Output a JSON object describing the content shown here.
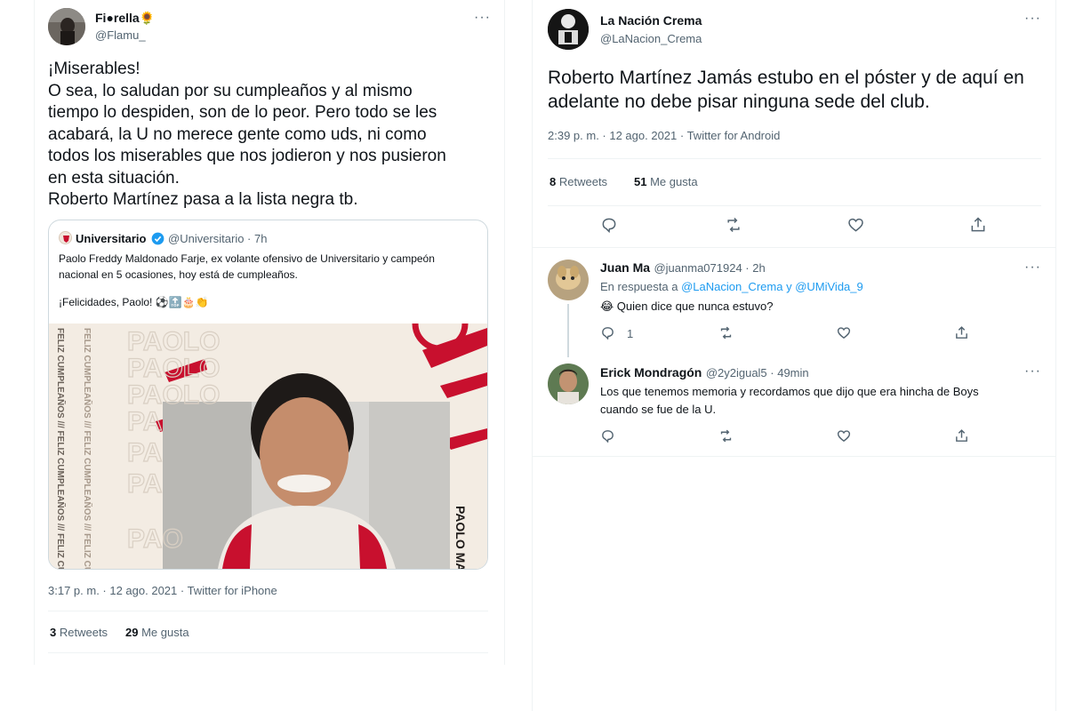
{
  "left_tweet": {
    "author_name": "Fi●rella🌻",
    "author_handle": "@Flamu_",
    "more": "···",
    "body_lines": [
      "¡Miserables!",
      "O sea, lo saludan por su cumpleaños y al mismo",
      "tiempo lo despiden, son de lo peor. Pero todo se les",
      "acabará, la U no merece gente como uds, ni como",
      "todos los miserables que nos jodieron y nos pusieron",
      "en esta situación.",
      "Roberto Martínez pasa a la lista negra tb."
    ],
    "quoted": {
      "author_name": "Universitario",
      "author_handle": "@Universitario · 7h",
      "text": "Paolo Freddy Maldonado Farje, ex volante ofensivo de Universitario y campeón nacional en 5 ocasiones, hoy está de cumpleaños.",
      "text2": "¡Felicidades, Paolo! ⚽🔝🎂👏",
      "photo_words": [
        "PAOLO",
        "PAOLO",
        "PAOLO",
        "PA",
        "PA",
        "PA",
        "PAO"
      ],
      "side_text_left": "FELIZ CUMPLEAÑOS /// FELIZ CUMPLEAÑOS /// FELIZ CUMPLEAÑOS",
      "side_text_right": "PAOLO MAL"
    },
    "timestamp": "3:17 p. m. · 12 ago. 2021 · Twitter for iPhone",
    "retweets_count": "3",
    "retweets_label": "Retweets",
    "likes_count": "29",
    "likes_label": "Me gusta"
  },
  "right_tweet": {
    "author_name": "La Nación Crema",
    "author_handle": "@LaNacion_Crema",
    "more": "···",
    "body": "Roberto Martínez Jamás estubo en el póster y de aquí en adelante no debe pisar ninguna sede del club.",
    "timestamp": "2:39 p. m. · 12 ago. 2021 · Twitter for Android",
    "retweets_count": "8",
    "retweets_label": "Retweets",
    "likes_count": "51",
    "likes_label": "Me gusta",
    "actions": [
      "reply-icon",
      "retweet-icon",
      "like-icon",
      "share-icon"
    ]
  },
  "replies": [
    {
      "name": "Juan Ma",
      "meta": "@juanma071924 · 2h",
      "more": "···",
      "reply_to_prefix": "En respuesta a",
      "reply_to_user1": "@LaNacion_Crema",
      "reply_to_and": "y",
      "reply_to_user2": "@UMiVida_9",
      "text": "😂 Quien dice que nunca estuvo?",
      "reply_count": "1"
    },
    {
      "name": "Erick Mondragón",
      "meta": "@2y2igual5 · 49min",
      "more": "···",
      "text_line1": "Los que tenemos memoria y recordamos que dijo que era hincha de Boys",
      "text_line2": "cuando se fue de la U."
    }
  ],
  "colors": {
    "text": "#0f1419",
    "secondary": "#536471",
    "link": "#1d9bf0",
    "border": "#eff3f4",
    "quote_border": "#cfd9de",
    "verified": "#1d9bf0",
    "universitario_red": "#c8102e"
  }
}
